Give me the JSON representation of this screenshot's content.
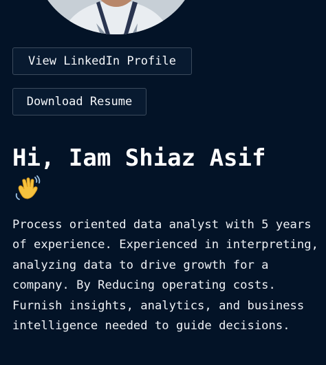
{
  "profile": {
    "linkedin_button": "View LinkedIn Profile",
    "resume_button": "Download Resume",
    "greeting": "Hi, Iam Shiaz Asif",
    "wave_emoji_icon": "waving-hand-icon",
    "bio": "Process oriented data analyst with 5 years of experience. Experienced in interpreting, analyzing data to drive growth for a company. By Reducing operating costs. Furnish insights, analytics, and business intelligence needed to guide decisions."
  },
  "colors": {
    "background": "#031327",
    "button_border": "#3b4a5c",
    "text": "#f2f4f7",
    "emoji": "#f6c23e"
  }
}
